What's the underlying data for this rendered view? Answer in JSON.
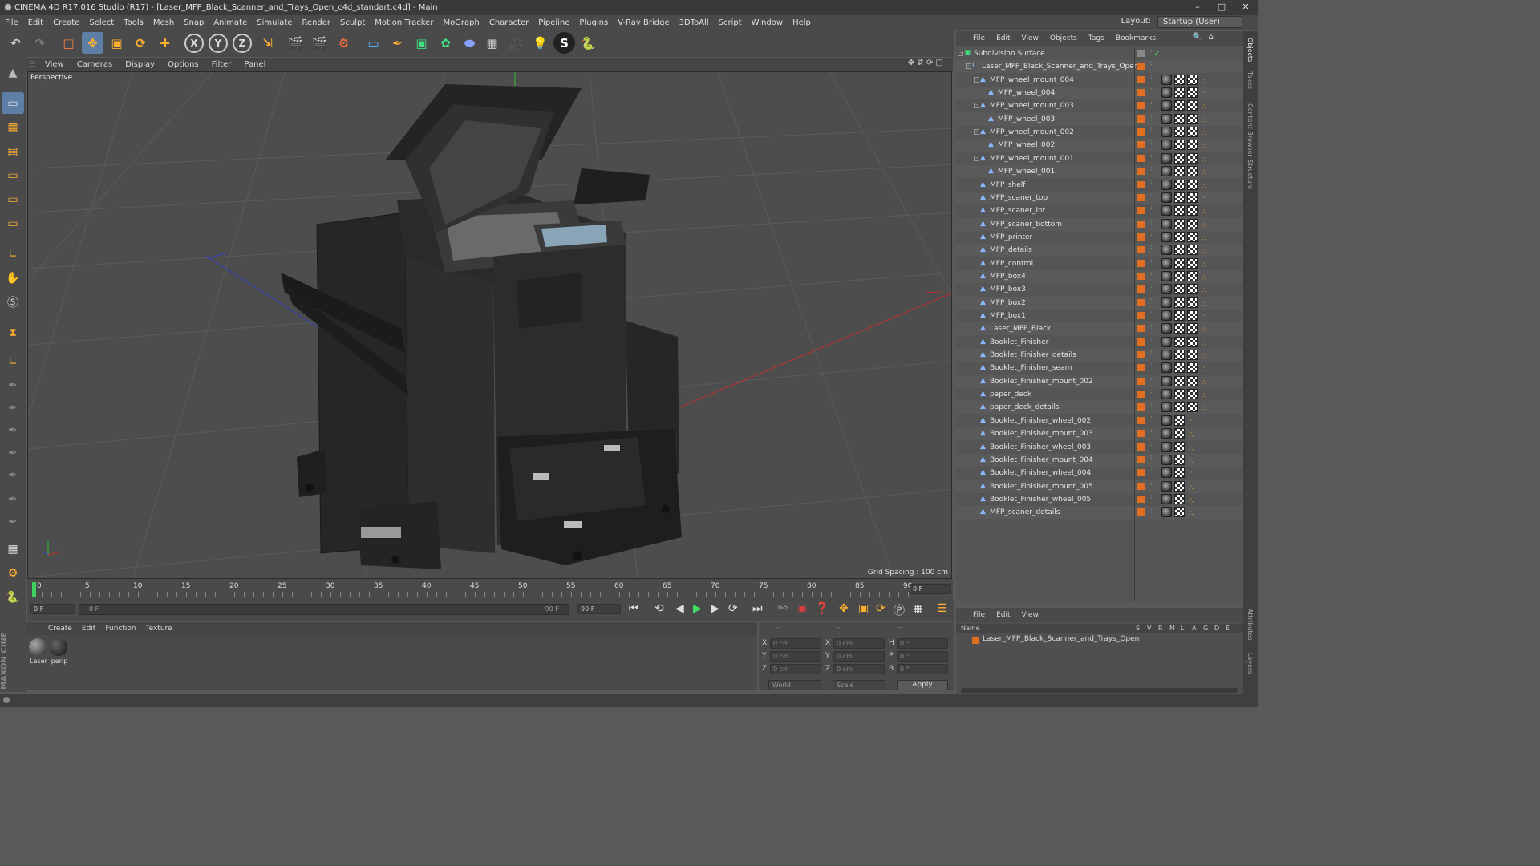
{
  "window": {
    "title": "CINEMA 4D R17.016 Studio (R17) - [Laser_MFP_Black_Scanner_and_Trays_Open_c4d_standart.c4d] - Main"
  },
  "menubar": {
    "items": [
      "File",
      "Edit",
      "Create",
      "Select",
      "Tools",
      "Mesh",
      "Snap",
      "Animate",
      "Simulate",
      "Render",
      "Sculpt",
      "Motion Tracker",
      "MoGraph",
      "Character",
      "Pipeline",
      "Plugins",
      "V-Ray Bridge",
      "3DToAll",
      "Script",
      "Window",
      "Help"
    ],
    "layout_label": "Layout:",
    "layout_value": "Startup (User)"
  },
  "toolbar": {
    "x_label": "X",
    "y_label": "Y",
    "z_label": "Z"
  },
  "viewport": {
    "menu": [
      "View",
      "Cameras",
      "Display",
      "Options",
      "Filter",
      "Panel"
    ],
    "label": "Perspective",
    "grid_spacing": "Grid Spacing : 100 cm"
  },
  "timeline": {
    "ticks": [
      "0",
      "5",
      "10",
      "15",
      "20",
      "25",
      "30",
      "35",
      "40",
      "45",
      "50",
      "55",
      "60",
      "65",
      "70",
      "75",
      "80",
      "85",
      "90"
    ],
    "frame_end_field": "0 F"
  },
  "transport": {
    "start_field": "0 F",
    "range_start": "0 F",
    "range_end": "90 F",
    "end_field": "90 F"
  },
  "materials": {
    "menu": [
      "Create",
      "Edit",
      "Function",
      "Texture"
    ],
    "items": [
      "Laser",
      "perip"
    ]
  },
  "coords": {
    "header": [
      "--",
      "--",
      "--"
    ],
    "rows": [
      {
        "a": "X",
        "av": "0 cm",
        "b": "X",
        "bv": "0 cm",
        "c": "H",
        "cv": "0 °"
      },
      {
        "a": "Y",
        "av": "0 cm",
        "b": "Y",
        "bv": "0 cm",
        "c": "P",
        "cv": "0 °"
      },
      {
        "a": "Z",
        "av": "0 cm",
        "b": "Z",
        "bv": "0 cm",
        "c": "B",
        "cv": "0 °"
      }
    ],
    "mode1": "World",
    "mode2": "Scale",
    "apply": "Apply"
  },
  "objects": {
    "menu": [
      "File",
      "Edit",
      "View",
      "Objects",
      "Tags",
      "Bookmarks"
    ],
    "rows": [
      {
        "name": "Subdivision Surface",
        "indent": 0
      },
      {
        "name": "Laser_MFP_Black_Scanner_and_Trays_Open",
        "indent": 1
      },
      {
        "name": "MFP_wheel_mount_004",
        "indent": 2
      },
      {
        "name": "MFP_wheel_004",
        "indent": 3
      },
      {
        "name": "MFP_wheel_mount_003",
        "indent": 2
      },
      {
        "name": "MFP_wheel_003",
        "indent": 3
      },
      {
        "name": "MFP_wheel_mount_002",
        "indent": 2
      },
      {
        "name": "MFP_wheel_002",
        "indent": 3
      },
      {
        "name": "MFP_wheel_mount_001",
        "indent": 2
      },
      {
        "name": "MFP_wheel_001",
        "indent": 3
      },
      {
        "name": "MFP_shelf",
        "indent": 2
      },
      {
        "name": "MFP_scaner_top",
        "indent": 2
      },
      {
        "name": "MFP_scaner_int",
        "indent": 2
      },
      {
        "name": "MFP_scaner_bottom",
        "indent": 2
      },
      {
        "name": "MFP_printer",
        "indent": 2
      },
      {
        "name": "MFP_details",
        "indent": 2
      },
      {
        "name": "MFP_control",
        "indent": 2
      },
      {
        "name": "MFP_box4",
        "indent": 2
      },
      {
        "name": "MFP_box3",
        "indent": 2
      },
      {
        "name": "MFP_box2",
        "indent": 2
      },
      {
        "name": "MFP_box1",
        "indent": 2
      },
      {
        "name": "Laser_MFP_Black",
        "indent": 2
      },
      {
        "name": "Booklet_Finisher",
        "indent": 2
      },
      {
        "name": "Booklet_Finisher_details",
        "indent": 2
      },
      {
        "name": "Booklet_Finisher_seam",
        "indent": 2
      },
      {
        "name": "Booklet_Finisher_mount_002",
        "indent": 2
      },
      {
        "name": "paper_deck",
        "indent": 2
      },
      {
        "name": "paper_deck_details",
        "indent": 2
      },
      {
        "name": "Booklet_Finisher_wheel_002",
        "indent": 2
      },
      {
        "name": "Booklet_Finisher_mount_003",
        "indent": 2
      },
      {
        "name": "Booklet_Finisher_wheel_003",
        "indent": 2
      },
      {
        "name": "Booklet_Finisher_mount_004",
        "indent": 2
      },
      {
        "name": "Booklet_Finisher_wheel_004",
        "indent": 2
      },
      {
        "name": "Booklet_Finisher_mount_005",
        "indent": 2
      },
      {
        "name": "Booklet_Finisher_wheel_005",
        "indent": 2
      },
      {
        "name": "MFP_scaner_details",
        "indent": 2
      }
    ]
  },
  "layers": {
    "menu": [
      "File",
      "Edit",
      "View"
    ],
    "col_name": "Name",
    "cols": [
      "S",
      "V",
      "R",
      "M",
      "L",
      "A",
      "G",
      "D",
      "E"
    ],
    "row": "Laser_MFP_Black_Scanner_and_Trays_Open"
  },
  "sidetabs": [
    "Objects",
    "Takes",
    "Content Browser",
    "Structure",
    "Attributes",
    "Layers"
  ],
  "brand": "MAXON CINEMA 4D"
}
